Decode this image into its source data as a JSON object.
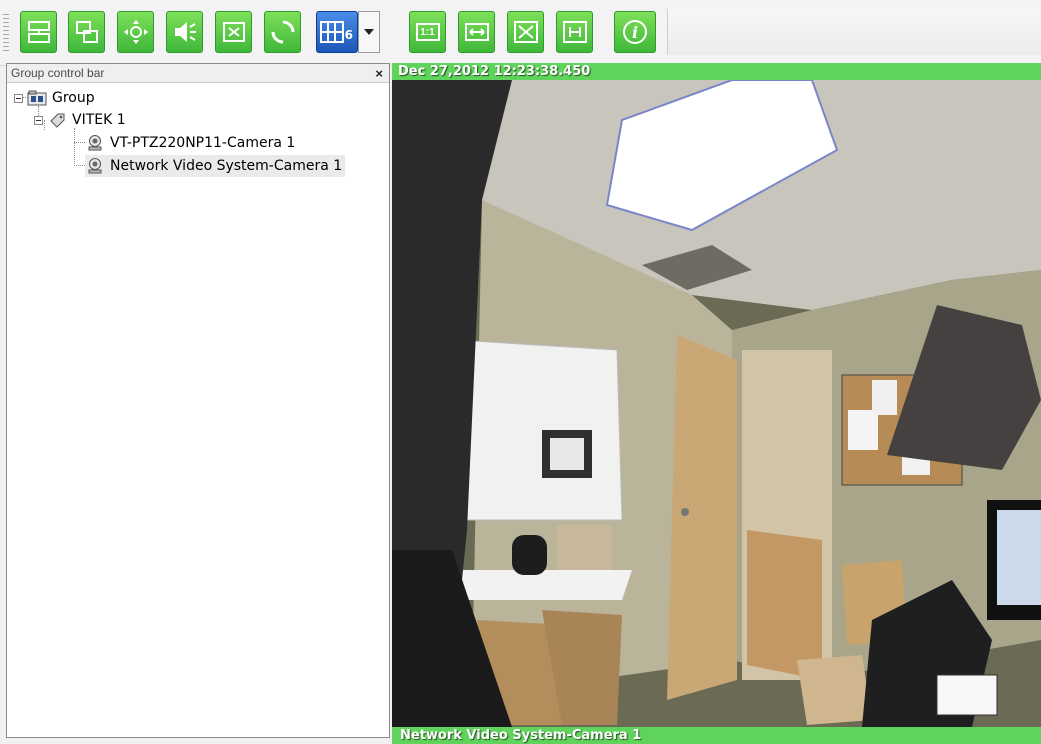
{
  "toolbar": {
    "buttons": [
      {
        "name": "device-tree-icon"
      },
      {
        "name": "window-layout-icon"
      },
      {
        "name": "ptz-control-icon"
      },
      {
        "name": "audio-speaker-icon"
      },
      {
        "name": "screen-capture-icon"
      },
      {
        "name": "refresh-cycle-icon"
      },
      {
        "name": "grid-layout-icon",
        "badge": "6"
      },
      {
        "name": "actual-size-icon",
        "label": "1:1"
      },
      {
        "name": "fit-width-icon"
      },
      {
        "name": "fullscreen-icon"
      },
      {
        "name": "fit-window-icon"
      },
      {
        "name": "info-icon",
        "label": "i"
      }
    ]
  },
  "panel": {
    "title": "Group control bar",
    "close": "×",
    "tree": {
      "root": "Group",
      "device": "VITEK 1",
      "cameras": [
        "VT-PTZ220NP11-Camera 1",
        "Network Video System-Camera 1"
      ],
      "selected_index": 1
    }
  },
  "video": {
    "timestamp": "Dec 27,2012 12:23:38.450",
    "camera_name": "Network Video System-Camera 1"
  },
  "colors": {
    "overlay_bar": "#5fd35b",
    "toolbar_button": "#4fc445",
    "grid_button": "#2a66c8"
  }
}
